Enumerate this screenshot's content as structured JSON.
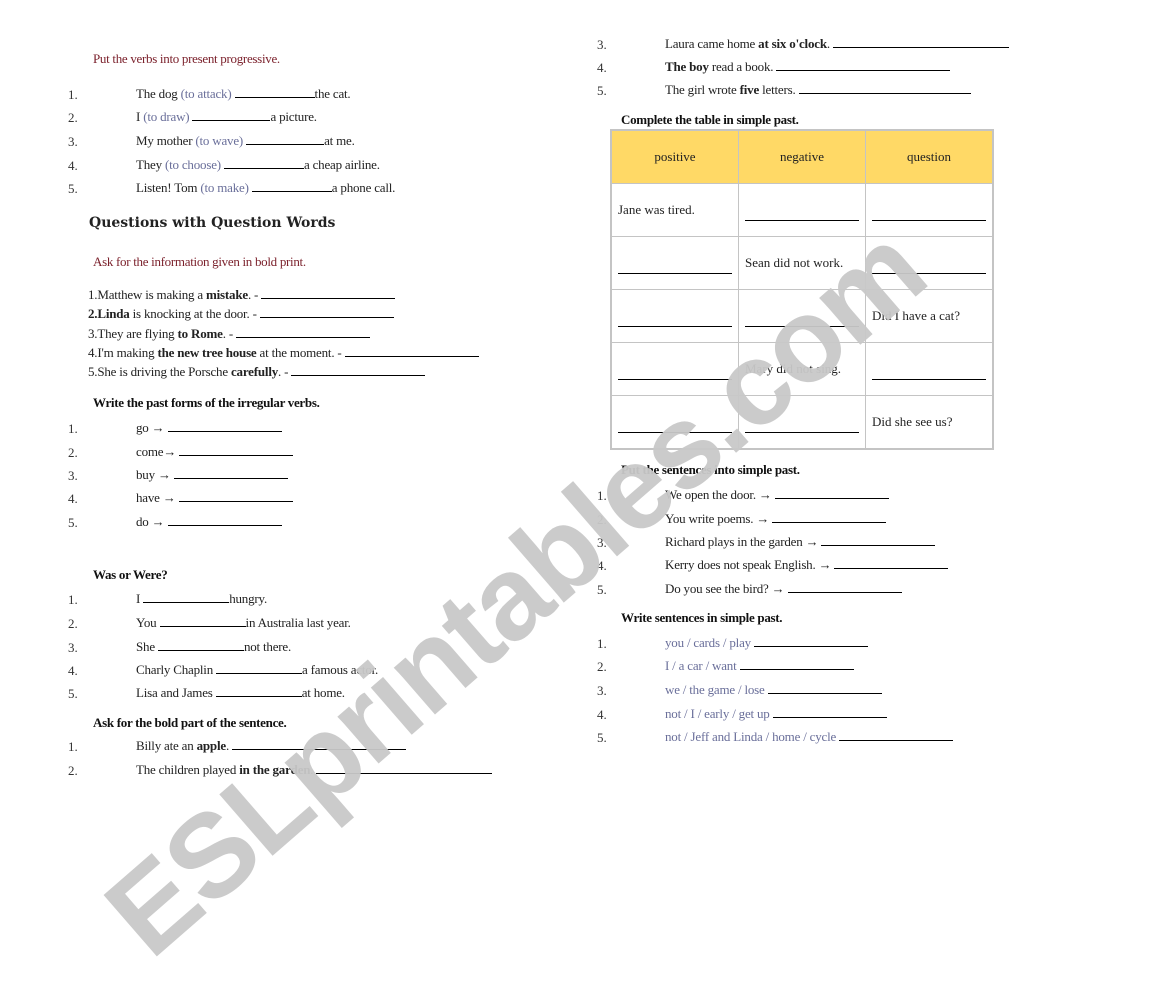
{
  "watermark": "ESLprintables.com",
  "left": {
    "progressive": {
      "instruction": "Put the verbs into present progressive.",
      "items": [
        {
          "num": "1.",
          "pre": "The dog ",
          "hint": "(to attack)",
          "post": "the cat."
        },
        {
          "num": "2.",
          "pre": "I ",
          "hint": "(to draw)",
          "post": "a picture."
        },
        {
          "num": "3.",
          "pre": "My mother ",
          "hint": "(to wave)",
          "post": "at me."
        },
        {
          "num": "4.",
          "pre": "They ",
          "hint": "(to choose)",
          "post": "a cheap airline."
        },
        {
          "num": "5.",
          "pre": "Listen!  Tom ",
          "hint": "(to make)",
          "post": "a phone call."
        }
      ]
    },
    "question_words": {
      "title": "Questions with Question Words",
      "instruction": "Ask for the information given in bold print.",
      "items": [
        {
          "pre": "1.Matthew is making a ",
          "bold": "mistake",
          "post": ". - "
        },
        {
          "boldpre": "2.Linda",
          "pre": "",
          "bold": "",
          "post": " is knocking at the door. - "
        },
        {
          "pre": "3.They are flying ",
          "bold": "to Rome",
          "post": ". - "
        },
        {
          "pre": "4.I'm making ",
          "bold": "the new tree house",
          "post": " at the moment. - "
        },
        {
          "pre": "5.She is driving the Porsche ",
          "bold": "carefully",
          "post": ". - "
        }
      ]
    },
    "irregular": {
      "heading": "Write the past forms of the irregular verbs.",
      "items": [
        {
          "num": "1.",
          "verb": "go"
        },
        {
          "num": "2.",
          "verb": "come"
        },
        {
          "num": "3.",
          "verb": "buy"
        },
        {
          "num": "4.",
          "verb": "have"
        },
        {
          "num": "5.",
          "verb": "do"
        }
      ],
      "arrow": "→"
    },
    "was_were": {
      "heading": "Was or Were?",
      "items": [
        {
          "num": "1.",
          "pre": "I ",
          "post": "hungry."
        },
        {
          "num": "2.",
          "pre": "You ",
          "post": "in Australia last year."
        },
        {
          "num": "3.",
          "pre": "She ",
          "post": "not there."
        },
        {
          "num": "4.",
          "pre": "Charly Chaplin ",
          "post": "a famous actor."
        },
        {
          "num": "5.",
          "pre": "Lisa and James ",
          "post": "at home."
        }
      ]
    },
    "bold_part": {
      "heading": "Ask for the bold part of the sentence.",
      "items": [
        {
          "num": "1.",
          "pre": "Billy ate an ",
          "bold": "apple",
          "post": ". "
        },
        {
          "num": "2.",
          "pre": "The children played ",
          "bold": "in the garden",
          "post": ". "
        }
      ]
    }
  },
  "right": {
    "bold_part_cont": {
      "items": [
        {
          "num": "3.",
          "pre": "Laura came home ",
          "bold": "at six o'clock",
          "post": ". "
        },
        {
          "num": "4.",
          "pre": "",
          "bold": "The boy",
          "post": " read a book. "
        },
        {
          "num": "5.",
          "pre": "The girl wrote ",
          "bold": "five",
          "post": " letters. "
        }
      ]
    },
    "table": {
      "heading": "Complete the table in simple past.",
      "columns": [
        "positive",
        "negative",
        "question"
      ],
      "rows": [
        [
          "Jane was tired.",
          "",
          ""
        ],
        [
          "",
          "Sean did not work.",
          ""
        ],
        [
          "",
          "",
          "Did I have a cat?"
        ],
        [
          "",
          "Mary did not sing.",
          ""
        ],
        [
          "",
          "",
          "Did she see us?"
        ]
      ],
      "header_color": "#ffd966"
    },
    "simple_past": {
      "heading": "Put the sentences into simple past.",
      "items": [
        {
          "num": "1.",
          "text": "We open the door.  →"
        },
        {
          "num": "2.",
          "text": "You write poems.  →"
        },
        {
          "num": "3.",
          "text": "Richard plays in the garden  →"
        },
        {
          "num": "4.",
          "text": "Kerry does not speak English.  →"
        },
        {
          "num": "5.",
          "text": "Do you see the bird? →"
        }
      ]
    },
    "write_sentences": {
      "heading": "Write sentences in simple past.",
      "items": [
        {
          "num": "1.",
          "text": "you / cards / play "
        },
        {
          "num": "2.",
          "text": "I / a car / want "
        },
        {
          "num": "3.",
          "text": "we / the game / lose "
        },
        {
          "num": "4.",
          "text": "not / I / early / get up "
        },
        {
          "num": "5.",
          "text": "not / Jeff and Linda / home / cycle "
        }
      ]
    }
  }
}
